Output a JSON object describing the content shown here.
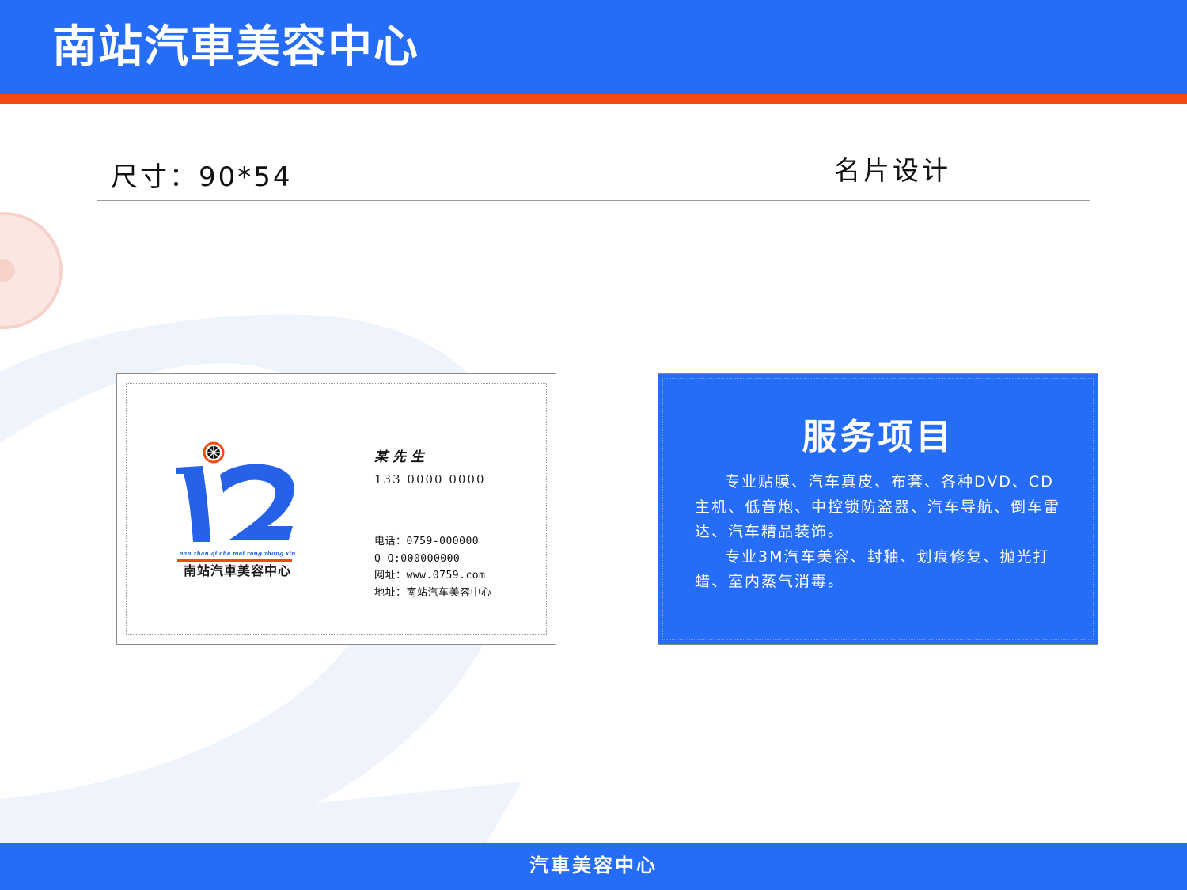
{
  "header": {
    "title": "南站汽車美容中心"
  },
  "spec": {
    "size_label": "尺寸：90*54",
    "section_label": "名片设计"
  },
  "card_front": {
    "logo_pinyin": "nan zhan qi che mei rong zhong xin",
    "logo_name": "南站汽車美容中心",
    "person_name": "某先生",
    "person_phone": "133 0000 0000",
    "tel": "电话：0759-000000",
    "qq": "Q  Q:000000000",
    "website": "网址：www.0759.com",
    "address": "地址：南站汽车美容中心"
  },
  "card_back": {
    "title": "服务项目",
    "paragraphs": [
      "专业贴膜、汽车真皮、布套、各种DVD、CD主机、低音炮、中控锁防盗器、汽车导航、倒车雷达、汽车精品装饰。",
      "专业3M汽车美容、封釉、划痕修复、抛光打蜡、室内蒸气消毒。"
    ]
  },
  "footer": {
    "title": "汽車美容中心"
  },
  "colors": {
    "brand_blue": "#256cf7",
    "accent_orange": "#f4490f"
  }
}
